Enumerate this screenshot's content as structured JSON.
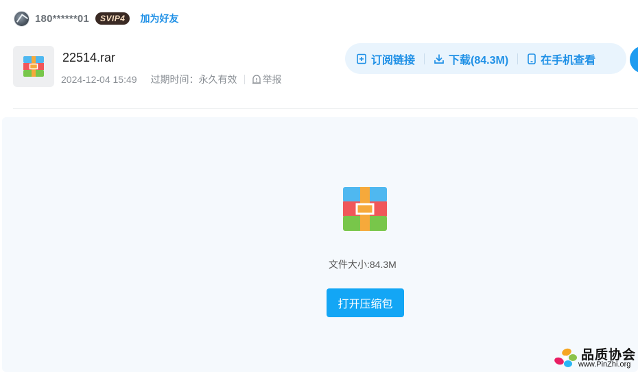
{
  "user": {
    "name": "180******01",
    "vip_label": "SVIP4",
    "add_friend_label": "加为好友"
  },
  "file": {
    "name": "22514.rar",
    "date": "2024-12-04 15:49",
    "expire_label": "过期时间：永久有效",
    "report_label": "举报"
  },
  "actions": {
    "subscribe_label": "订阅链接",
    "download_label": "下载(84.3M)",
    "mobile_label": "在手机查看"
  },
  "preview": {
    "size_label": "文件大小:84.3M",
    "open_label": "打开压缩包"
  },
  "watermark": {
    "name": "品质协会",
    "url": "www.PinZhi.org"
  },
  "colors": {
    "accent": "#1f90e6",
    "button": "#13a6f5",
    "pill_bg": "#e9f4fd",
    "preview_bg": "#f5f9fd"
  }
}
